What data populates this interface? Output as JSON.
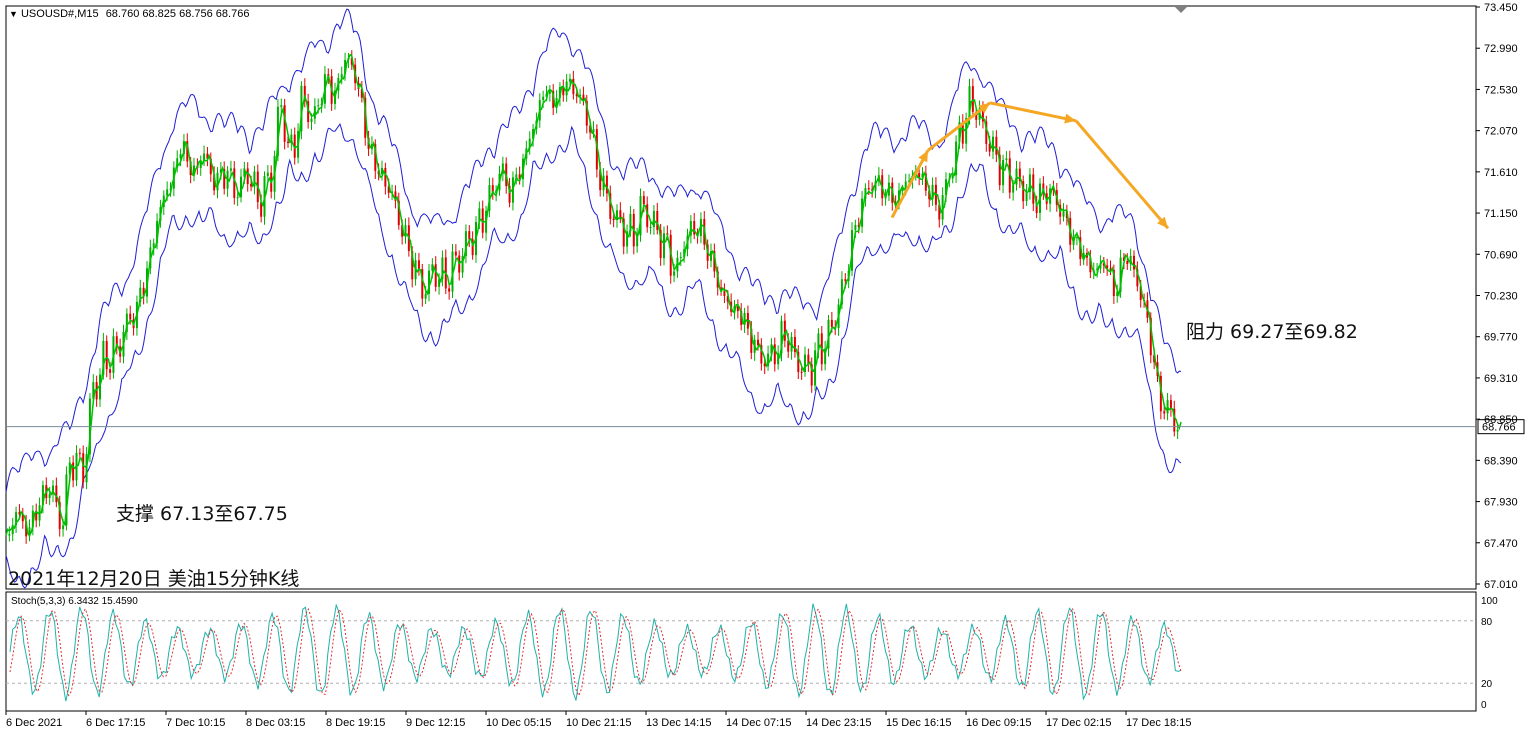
{
  "header": {
    "symbol": "USOUSD#,M15",
    "ohlc": "68.760 68.825 68.756 68.766"
  },
  "indicator": {
    "label": "Stoch(5,3,3) 6.3432 15.4590",
    "levels": [
      0,
      20,
      80,
      100
    ]
  },
  "annotations": {
    "support": "支撑 67.13至67.75",
    "resistance": "阻力 69.27至69.82",
    "chart_title": "2021年12月20日 美油15分钟K线"
  },
  "colors": {
    "axis": "#000000",
    "band": "#1f1fd6",
    "ma": "#00c000",
    "bull": "#00b000",
    "bear": "#e00000",
    "arrow": "#f5a623",
    "stoch_main": "#20b2aa",
    "stoch_signal": "#e03030",
    "last_price_bg": "#ffffff"
  },
  "chart_data": [
    {
      "type": "line",
      "panel": "price",
      "last_price": 68.766,
      "ylim": [
        67.01,
        73.45
      ],
      "y_ticks": [
        73.45,
        72.99,
        72.53,
        72.07,
        71.61,
        71.15,
        70.69,
        70.23,
        69.77,
        69.31,
        68.85,
        68.39,
        67.93,
        67.47,
        67.01
      ],
      "x_ticks": [
        "6 Dec 2021",
        "6 Dec 17:15",
        "7 Dec 10:15",
        "8 Dec 03:15",
        "8 Dec 19:15",
        "9 Dec 12:15",
        "10 Dec 05:15",
        "10 Dec 21:15",
        "13 Dec 14:15",
        "14 Dec 07:15",
        "14 Dec 23:15",
        "15 Dec 16:15",
        "16 Dec 09:15",
        "17 Dec 02:15",
        "17 Dec 18:15"
      ],
      "price_path": [
        [
          0,
          67.5
        ],
        [
          1,
          67.8
        ],
        [
          2,
          67.6
        ],
        [
          3,
          67.9
        ],
        [
          4,
          68.1
        ],
        [
          5,
          67.7
        ],
        [
          6,
          68.4
        ],
        [
          7,
          68.3
        ],
        [
          8,
          69.2
        ],
        [
          9,
          69.5
        ],
        [
          10,
          69.6
        ],
        [
          11,
          69.9
        ],
        [
          12,
          70.1
        ],
        [
          13,
          70.6
        ],
        [
          14,
          71.2
        ],
        [
          15,
          71.5
        ],
        [
          16,
          71.9
        ],
        [
          17,
          71.6
        ],
        [
          18,
          71.8
        ],
        [
          19,
          71.5
        ],
        [
          20,
          71.6
        ],
        [
          21,
          71.4
        ],
        [
          22,
          71.6
        ],
        [
          23,
          71.3
        ],
        [
          24,
          71.5
        ],
        [
          25,
          72.3
        ],
        [
          26,
          71.8
        ],
        [
          27,
          72.4
        ],
        [
          28,
          72.2
        ],
        [
          29,
          72.6
        ],
        [
          30,
          72.5
        ],
        [
          31,
          72.9
        ],
        [
          32,
          72.6
        ],
        [
          33,
          71.9
        ],
        [
          34,
          71.6
        ],
        [
          35,
          71.4
        ],
        [
          36,
          71.0
        ],
        [
          37,
          70.6
        ],
        [
          38,
          70.3
        ],
        [
          39,
          70.5
        ],
        [
          40,
          70.4
        ],
        [
          41,
          70.6
        ],
        [
          42,
          70.8
        ],
        [
          43,
          71.0
        ],
        [
          44,
          71.3
        ],
        [
          45,
          71.6
        ],
        [
          46,
          71.4
        ],
        [
          47,
          71.7
        ],
        [
          48,
          72.1
        ],
        [
          49,
          72.5
        ],
        [
          50,
          72.4
        ],
        [
          51,
          72.6
        ],
        [
          52,
          72.5
        ],
        [
          53,
          72.2
        ],
        [
          54,
          71.6
        ],
        [
          55,
          71.2
        ],
        [
          56,
          71.0
        ],
        [
          57,
          70.9
        ],
        [
          58,
          71.2
        ],
        [
          59,
          71.0
        ],
        [
          60,
          70.8
        ],
        [
          61,
          70.5
        ],
        [
          62,
          70.9
        ],
        [
          63,
          71.0
        ],
        [
          64,
          70.7
        ],
        [
          65,
          70.3
        ],
        [
          66,
          70.1
        ],
        [
          67,
          70.0
        ],
        [
          68,
          69.7
        ],
        [
          69,
          69.5
        ],
        [
          70,
          69.6
        ],
        [
          71,
          69.8
        ],
        [
          72,
          69.5
        ],
        [
          73,
          69.4
        ],
        [
          74,
          69.6
        ],
        [
          75,
          69.8
        ],
        [
          76,
          70.2
        ],
        [
          77,
          70.8
        ],
        [
          78,
          71.3
        ],
        [
          79,
          71.5
        ],
        [
          80,
          71.4
        ],
        [
          81,
          71.3
        ],
        [
          82,
          71.5
        ],
        [
          83,
          71.6
        ],
        [
          84,
          71.4
        ],
        [
          85,
          71.2
        ],
        [
          86,
          71.6
        ],
        [
          87,
          72.1
        ],
        [
          88,
          72.4
        ],
        [
          89,
          72.1
        ],
        [
          90,
          71.8
        ],
        [
          91,
          71.6
        ],
        [
          92,
          71.5
        ],
        [
          93,
          71.4
        ],
        [
          94,
          71.3
        ],
        [
          95,
          71.4
        ],
        [
          96,
          71.2
        ],
        [
          97,
          70.9
        ],
        [
          98,
          70.7
        ],
        [
          99,
          70.5
        ],
        [
          100,
          70.6
        ],
        [
          101,
          70.3
        ],
        [
          102,
          70.7
        ],
        [
          103,
          70.4
        ],
        [
          104,
          69.9
        ],
        [
          105,
          69.1
        ],
        [
          106,
          68.9
        ],
        [
          107,
          68.77
        ]
      ],
      "trend_arrows": [
        [
          [
            0,
            71.1
          ],
          [
            1,
            71.85
          ]
        ],
        [
          [
            1,
            71.85
          ],
          [
            2,
            72.38
          ]
        ],
        [
          [
            2,
            72.38
          ],
          [
            3,
            72.18
          ]
        ],
        [
          [
            3,
            72.18
          ],
          [
            4,
            70.98
          ]
        ]
      ]
    },
    {
      "type": "line",
      "panel": "stochastic",
      "ylim": [
        0,
        100
      ],
      "y_ticks": [
        100,
        80,
        20,
        0
      ]
    }
  ]
}
